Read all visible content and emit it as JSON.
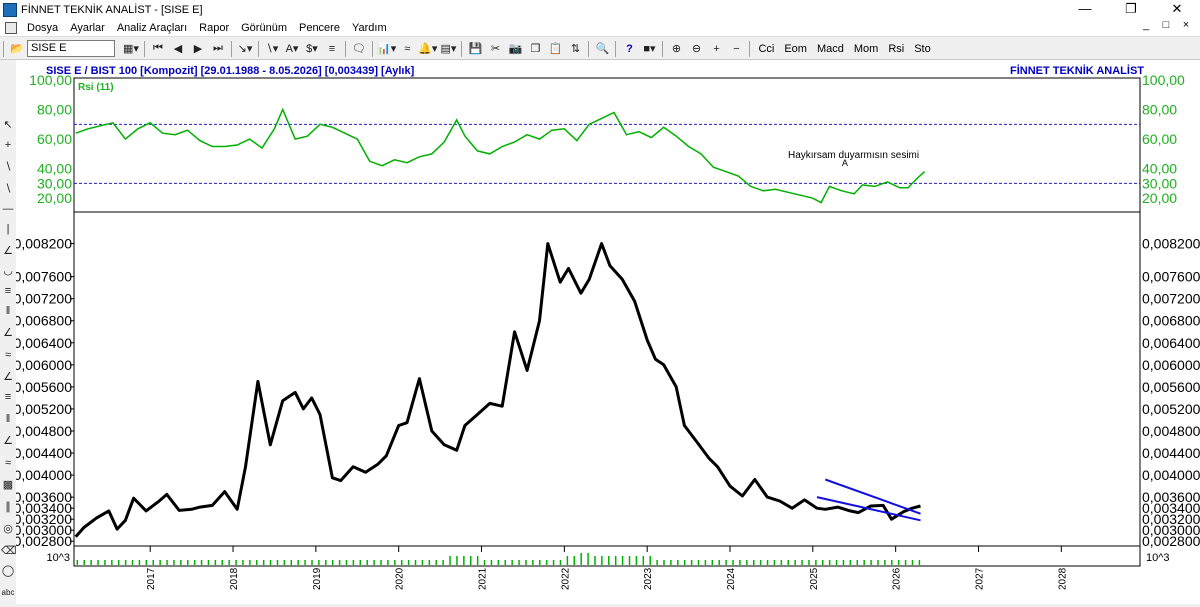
{
  "window": {
    "title": "FİNNET TEKNİK ANALİST - [SISE  E]"
  },
  "menu": [
    "Dosya",
    "Ayarlar",
    "Analiz Araçları",
    "Rapor",
    "Görünüm",
    "Pencere",
    "Yardım"
  ],
  "toolbar": {
    "symbol": "SISE  E",
    "indicators": [
      "Cci",
      "Eom",
      "Macd",
      "Mom",
      "Rsi",
      "Sto"
    ]
  },
  "header": {
    "info": "SISE  E / BIST 100 [Kompozit]  [29.01.1988 - 8.05.2026]  [0,003439]  [Aylık]",
    "brand": "FİNNET TEKNİK ANALİST",
    "brand_color": "#0000c0"
  },
  "chart_data": [
    {
      "type": "line",
      "title": "Rsi (11)",
      "color": "#00b000",
      "ylim": [
        12,
        100
      ],
      "y_ticks": [
        "100,00",
        "80,00",
        "60,00",
        "40,00",
        "30,00",
        "20,00"
      ],
      "y_tick_values": [
        100,
        80,
        60,
        40,
        30,
        20
      ],
      "reference_lines": [
        70,
        30
      ],
      "annotation": "Haykırsam duyarmısın sesimi",
      "x": [
        2016.1,
        2016.25,
        2016.4,
        2016.55,
        2016.7,
        2016.85,
        2017.0,
        2017.15,
        2017.3,
        2017.45,
        2017.6,
        2017.75,
        2017.9,
        2018.05,
        2018.2,
        2018.35,
        2018.5,
        2018.6,
        2018.75,
        2018.9,
        2019.05,
        2019.2,
        2019.35,
        2019.5,
        2019.65,
        2019.8,
        2019.95,
        2020.1,
        2020.25,
        2020.4,
        2020.55,
        2020.7,
        2020.8,
        2020.95,
        2021.1,
        2021.25,
        2021.4,
        2021.55,
        2021.7,
        2021.85,
        2022.0,
        2022.15,
        2022.3,
        2022.45,
        2022.6,
        2022.75,
        2022.9,
        2023.05,
        2023.2,
        2023.35,
        2023.5,
        2023.65,
        2023.8,
        2023.95,
        2024.1,
        2024.25,
        2024.4,
        2024.55,
        2024.7,
        2024.85,
        2025.0,
        2025.1,
        2025.2,
        2025.35,
        2025.5,
        2025.6,
        2025.75,
        2025.9,
        2026.05,
        2026.15,
        2026.25,
        2026.35
      ],
      "values": [
        64,
        67,
        69,
        71,
        60,
        67,
        71,
        64,
        63,
        66,
        59,
        55,
        55,
        56,
        60,
        54,
        67,
        80,
        60,
        62,
        70,
        68,
        64,
        60,
        45,
        42,
        46,
        44,
        48,
        50,
        58,
        73,
        62,
        52,
        50,
        55,
        58,
        63,
        60,
        66,
        67,
        59,
        70,
        74,
        78,
        63,
        65,
        61,
        68,
        62,
        55,
        50,
        41,
        38,
        35,
        28,
        25,
        26,
        24,
        22,
        20,
        17,
        28,
        25,
        23,
        29,
        28,
        31,
        27,
        27,
        33,
        38
      ]
    },
    {
      "type": "line",
      "color": "#000000",
      "ylim": [
        0.00275,
        0.0087
      ],
      "y_ticks": [
        "0,008200",
        "0,007600",
        "0,007200",
        "0,006800",
        "0,006400",
        "0,006000",
        "0,005600",
        "0,005200",
        "0,004800",
        "0,004400",
        "0,004000",
        "0,003600",
        "0,003400",
        "0,003200",
        "0,003000",
        "0,002800"
      ],
      "y_tick_values": [
        0.0082,
        0.0076,
        0.0072,
        0.0068,
        0.0064,
        0.006,
        0.0056,
        0.0052,
        0.0048,
        0.0044,
        0.004,
        0.0036,
        0.0034,
        0.0032,
        0.003,
        0.0028
      ],
      "xlim": [
        2016.08,
        2028.95
      ],
      "x_ticks": [
        "2017",
        "2018",
        "2019",
        "2020",
        "2021",
        "2022",
        "2023",
        "2024",
        "2025",
        "2026",
        "2027",
        "2028"
      ],
      "x": [
        2016.1,
        2016.2,
        2016.35,
        2016.5,
        2016.6,
        2016.7,
        2016.8,
        2016.95,
        2017.1,
        2017.2,
        2017.35,
        2017.5,
        2017.6,
        2017.75,
        2017.9,
        2018.05,
        2018.15,
        2018.3,
        2018.45,
        2018.6,
        2018.75,
        2018.85,
        2018.95,
        2019.05,
        2019.2,
        2019.3,
        2019.45,
        2019.6,
        2019.75,
        2019.85,
        2020.0,
        2020.1,
        2020.25,
        2020.4,
        2020.55,
        2020.7,
        2020.8,
        2020.95,
        2021.1,
        2021.25,
        2021.4,
        2021.55,
        2021.7,
        2021.8,
        2021.95,
        2022.05,
        2022.2,
        2022.3,
        2022.45,
        2022.55,
        2022.7,
        2022.85,
        2023.0,
        2023.1,
        2023.2,
        2023.35,
        2023.45,
        2023.6,
        2023.75,
        2023.85,
        2024.0,
        2024.15,
        2024.3,
        2024.45,
        2024.6,
        2024.75,
        2024.9,
        2025.05,
        2025.15,
        2025.3,
        2025.45,
        2025.55,
        2025.7,
        2025.85,
        2025.95,
        2026.1,
        2026.2,
        2026.3
      ],
      "values": [
        0.00288,
        0.00305,
        0.00322,
        0.00335,
        0.00302,
        0.00318,
        0.00358,
        0.00335,
        0.00352,
        0.00365,
        0.00336,
        0.00338,
        0.00342,
        0.00345,
        0.0037,
        0.00338,
        0.00415,
        0.0057,
        0.00455,
        0.00535,
        0.0055,
        0.0052,
        0.0054,
        0.0051,
        0.00395,
        0.0039,
        0.00415,
        0.00405,
        0.0042,
        0.00435,
        0.0049,
        0.00495,
        0.00575,
        0.0048,
        0.00455,
        0.00445,
        0.0049,
        0.0051,
        0.0053,
        0.00525,
        0.0066,
        0.0059,
        0.0068,
        0.0082,
        0.0075,
        0.00775,
        0.0073,
        0.00755,
        0.0082,
        0.0078,
        0.00755,
        0.00715,
        0.00645,
        0.0061,
        0.006,
        0.0056,
        0.0049,
        0.0046,
        0.0043,
        0.00415,
        0.0038,
        0.00362,
        0.00392,
        0.0036,
        0.00353,
        0.0034,
        0.00355,
        0.0034,
        0.00338,
        0.00342,
        0.00335,
        0.00332,
        0.00344,
        0.00345,
        0.0032,
        0.00334,
        0.0034,
        0.00344
      ],
      "trendlines": [
        {
          "x": [
            2025.15,
            2026.3
          ],
          "values": [
            0.00392,
            0.0033
          ],
          "color": "#1010e0"
        },
        {
          "x": [
            2025.05,
            2026.3
          ],
          "values": [
            0.0036,
            0.00318
          ],
          "color": "#1010e0"
        }
      ]
    },
    {
      "type": "bar",
      "y_label": "10^3",
      "color": "#00b000"
    }
  ]
}
